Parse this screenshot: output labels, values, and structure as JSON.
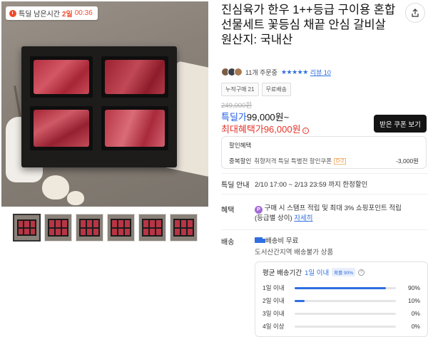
{
  "timer": {
    "label": "특딜 남은시간",
    "days": "2일",
    "time": "00:36"
  },
  "product": {
    "title": "진심육가 한우 1++등급 구이용 혼합 선물세트 꽃등심 채끝 안심 갈비살 원산지: 국내산",
    "order_count": "11개 주문중",
    "review_label": "리뷰 10",
    "rating_stars": 5,
    "tags": [
      "누적구매 21",
      "무료배송"
    ],
    "original_price": "249,000원",
    "deal_label": "특딜가",
    "deal_price": "99,000원",
    "deal_suffix": "~",
    "max_benefit_label": "최대혜택가",
    "max_benefit_price": "96,000원",
    "coupon_button": "받은 쿠폰 보기"
  },
  "discount": {
    "title": "할인혜택",
    "dup_label": "중복할인",
    "dup_text": "취향저격 특딜 특별전 할인쿠폰",
    "dday": "D-2",
    "amount": "-3,000원"
  },
  "deal_info": {
    "label": "특딜 안내",
    "text": "2/10 17:00 ~ 2/13 23:59 까지 한정할인"
  },
  "benefit": {
    "label": "혜택",
    "icon": "P",
    "line1": "구매 시 스탬프 적립 및 최대 3% 쇼핑포인트 적립",
    "line2": "(등급별 상이)",
    "detail_link": "자세히"
  },
  "shipping": {
    "label": "배송",
    "fee": "배송비 무료",
    "restriction": "도서산간지역 배송불가 상품",
    "avg_label": "평균 배송기간",
    "avg_value": "1일 이내",
    "badge": "확률 90%",
    "rows": [
      {
        "label": "1일 이내",
        "percent": 90,
        "pct_text": "90%"
      },
      {
        "label": "2일 이내",
        "percent": 10,
        "pct_text": "10%"
      },
      {
        "label": "3일 이내",
        "percent": 0,
        "pct_text": "0%"
      },
      {
        "label": "4일 이상",
        "percent": 0,
        "pct_text": "0%"
      }
    ]
  },
  "colors": {
    "accent": "#2f6fe0",
    "sale_red": "#e5332a",
    "timer_red": "#f04a2a"
  },
  "icons": [
    "share-icon",
    "clock-icon",
    "info-icon",
    "question-icon",
    "truck-icon",
    "point-icon"
  ]
}
